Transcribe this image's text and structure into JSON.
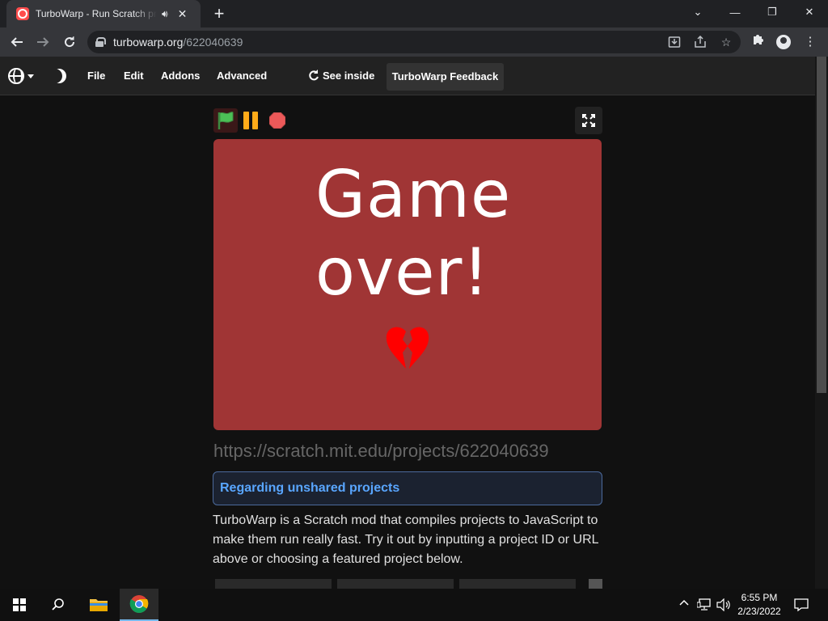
{
  "browser": {
    "tab_title": "TurboWarp - Run Scratch projects faster",
    "tab_audio_icon": "speaker-icon",
    "new_tab": "+",
    "url_host": "turbowarp.org",
    "url_path": "/622040639",
    "window_controls": {
      "minimize": "—",
      "maximize": "❐",
      "close": "✕",
      "tab_search": "⌄"
    }
  },
  "menubar": {
    "file": "File",
    "edit": "Edit",
    "addons": "Addons",
    "advanced": "Advanced",
    "see_inside": "See inside",
    "feedback": "TurboWarp Feedback"
  },
  "stage": {
    "line1": "Game",
    "line2": "over!",
    "background": "#a03535",
    "heart_color": "#ff0000"
  },
  "page": {
    "project_url": "https://scratch.mit.edu/projects/622040639",
    "notice": "Regarding unshared projects",
    "description": "TurboWarp is a Scratch mod that compiles projects to JavaScript to make them run really fast. Try it out by inputting a project ID or URL above or choosing a featured project below."
  },
  "taskbar": {
    "time": "6:55 PM",
    "date": "2/23/2022"
  },
  "colors": {
    "accent_link": "#59a6ff",
    "flag_green": "#4cbf56",
    "pause_orange": "#ffab19",
    "stop_red": "#ec5959"
  }
}
